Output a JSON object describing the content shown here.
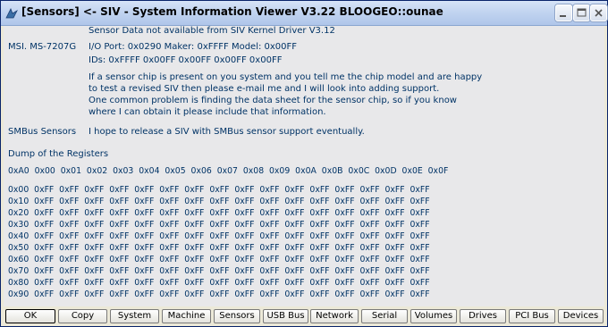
{
  "window": {
    "title": "[Sensors] <- SIV - System Information Viewer V3.22 BLOOGEO::ounae"
  },
  "sensors": {
    "driver_note": "Sensor Data not available from SIV Kernel Driver V3.12",
    "board_label": "MSI. MS-7207G",
    "io_line": "I/O Port: 0x0290  Maker: 0xFFFF  Model: 0x00FF",
    "ids_line": "IDs: 0xFFFF 0x00FF 0x00FF 0x00FF 0x00FF",
    "message": [
      "If a sensor chip is present on you system and you tell me the chip model and are happy",
      "to test a revised SIV then please e-mail me and I will look into adding support.",
      "One common problem is finding the data sheet for the sensor chip, so if you know",
      "where I can obtain it please include that information."
    ],
    "smbus_label": "SMBus Sensors",
    "smbus_text": "I hope to release a SIV with SMBus sensor support eventually."
  },
  "registers": {
    "heading": "Dump of the Registers",
    "header_row": "0xA0  0x00  0x01  0x02  0x03  0x04  0x05  0x06  0x07  0x08  0x09  0x0A  0x0B  0x0C  0x0D  0x0E  0x0F",
    "rows": [
      "0x00  0xFF  0xFF  0xFF  0xFF  0xFF  0xFF  0xFF  0xFF  0xFF  0xFF  0xFF  0xFF  0xFF  0xFF  0xFF  0xFF",
      "0x10  0xFF  0xFF  0xFF  0xFF  0xFF  0xFF  0xFF  0xFF  0xFF  0xFF  0xFF  0xFF  0xFF  0xFF  0xFF  0xFF",
      "0x20  0xFF  0xFF  0xFF  0xFF  0xFF  0xFF  0xFF  0xFF  0xFF  0xFF  0xFF  0xFF  0xFF  0xFF  0xFF  0xFF",
      "0x30  0xFF  0xFF  0xFF  0xFF  0xFF  0xFF  0xFF  0xFF  0xFF  0xFF  0xFF  0xFF  0xFF  0xFF  0xFF  0xFF",
      "0x40  0xFF  0xFF  0xFF  0xFF  0xFF  0xFF  0xFF  0xFF  0xFF  0xFF  0xFF  0xFF  0xFF  0xFF  0xFF  0xFF",
      "0x50  0xFF  0xFF  0xFF  0xFF  0xFF  0xFF  0xFF  0xFF  0xFF  0xFF  0xFF  0xFF  0xFF  0xFF  0xFF  0xFF",
      "0x60  0xFF  0xFF  0xFF  0xFF  0xFF  0xFF  0xFF  0xFF  0xFF  0xFF  0xFF  0xFF  0xFF  0xFF  0xFF  0xFF",
      "0x70  0xFF  0xFF  0xFF  0xFF  0xFF  0xFF  0xFF  0xFF  0xFF  0xFF  0xFF  0xFF  0xFF  0xFF  0xFF  0xFF",
      "0x80  0xFF  0xFF  0xFF  0xFF  0xFF  0xFF  0xFF  0xFF  0xFF  0xFF  0xFF  0xFF  0xFF  0xFF  0xFF  0xFF",
      "0x90  0xFF  0xFF  0xFF  0xFF  0xFF  0xFF  0xFF  0xFF  0xFF  0xFF  0xFF  0xFF  0xFF  0xFF  0xFF  0xFF"
    ]
  },
  "buttons": [
    "OK",
    "Copy",
    "System",
    "Machine",
    "Sensors",
    "USB Bus",
    "Network",
    "Serial",
    "Volumes",
    "Drives",
    "PCI Bus",
    "Devices"
  ],
  "colors": {
    "text": "#003366",
    "content_bg": "#e8e8ea",
    "titlebar": "#c2d4f0"
  },
  "icons": {
    "app": "siv-app-icon",
    "minimize": "minimize-icon",
    "maximize": "maximize-icon",
    "close": "close-icon"
  }
}
